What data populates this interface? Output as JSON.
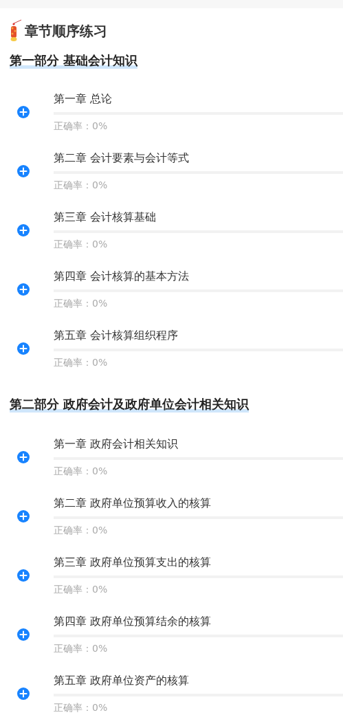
{
  "title": "章节顺序练习",
  "parts": [
    {
      "heading": "第一部分 基础会计知识",
      "chapters": [
        {
          "title": "第一章 总论",
          "accuracy": "正确率：0%"
        },
        {
          "title": "第二章 会计要素与会计等式",
          "accuracy": "正确率：0%"
        },
        {
          "title": "第三章 会计核算基础",
          "accuracy": "正确率：0%"
        },
        {
          "title": "第四章 会计核算的基本方法",
          "accuracy": "正确率：0%"
        },
        {
          "title": "第五章 会计核算组织程序",
          "accuracy": "正确率：0%"
        }
      ]
    },
    {
      "heading": "第二部分 政府会计及政府单位会计相关知识",
      "chapters": [
        {
          "title": "第一章 政府会计相关知识",
          "accuracy": "正确率：0%"
        },
        {
          "title": "第二章 政府单位预算收入的核算",
          "accuracy": "正确率：0%"
        },
        {
          "title": "第三章 政府单位预算支出的核算",
          "accuracy": "正确率：0%"
        },
        {
          "title": "第四章 政府单位预算结余的核算",
          "accuracy": "正确率：0%"
        },
        {
          "title": "第五章 政府单位资产的核算",
          "accuracy": "正确率：0%"
        }
      ]
    }
  ]
}
